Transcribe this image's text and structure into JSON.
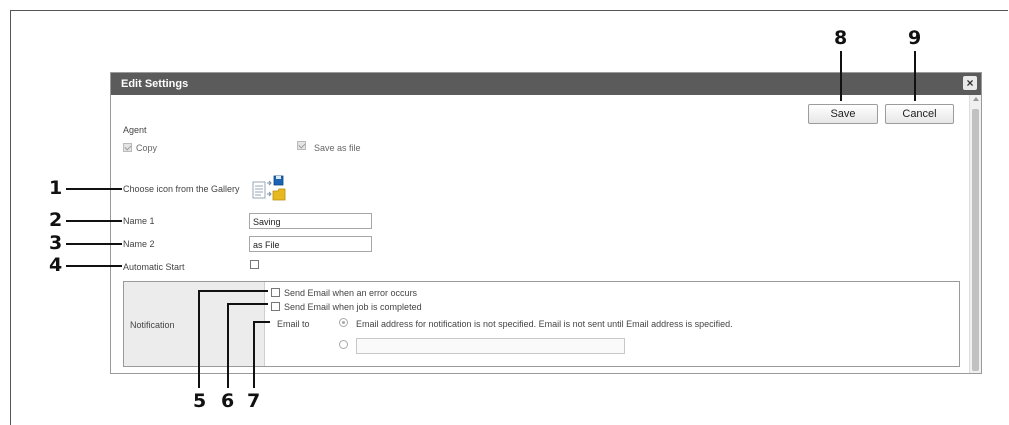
{
  "dialog": {
    "title": "Edit Settings",
    "close_glyph": "×"
  },
  "toolbar": {
    "save_label": "Save",
    "cancel_label": "Cancel"
  },
  "agent": {
    "heading": "Agent",
    "items": [
      {
        "label": "Copy",
        "checked": true,
        "disabled": true
      },
      {
        "label": "Save as file",
        "checked": true,
        "disabled": true
      }
    ]
  },
  "form": {
    "icon_label": "Choose icon from the Gallery",
    "icon_name": "document-to-folder-icon",
    "name1_label": "Name 1",
    "name1_value": "Saving",
    "name2_label": "Name 2",
    "name2_value": "as File",
    "autostart_label": "Automatic Start",
    "autostart_checked": false
  },
  "notification": {
    "heading": "Notification",
    "error_label": "Send Email when an error occurs",
    "completed_label": "Send Email when job is completed",
    "email_to_label": "Email to",
    "email_option1": "Email address for notification is not specified. Email is not sent until Email address is specified.",
    "email_input_value": ""
  },
  "callouts": [
    "1",
    "2",
    "3",
    "4",
    "5",
    "6",
    "7",
    "8",
    "9"
  ],
  "colors": {
    "titlebar": "#5b5b5b",
    "notification_header": "#ececec",
    "folder": "#e8b820",
    "callout": "#111111"
  }
}
